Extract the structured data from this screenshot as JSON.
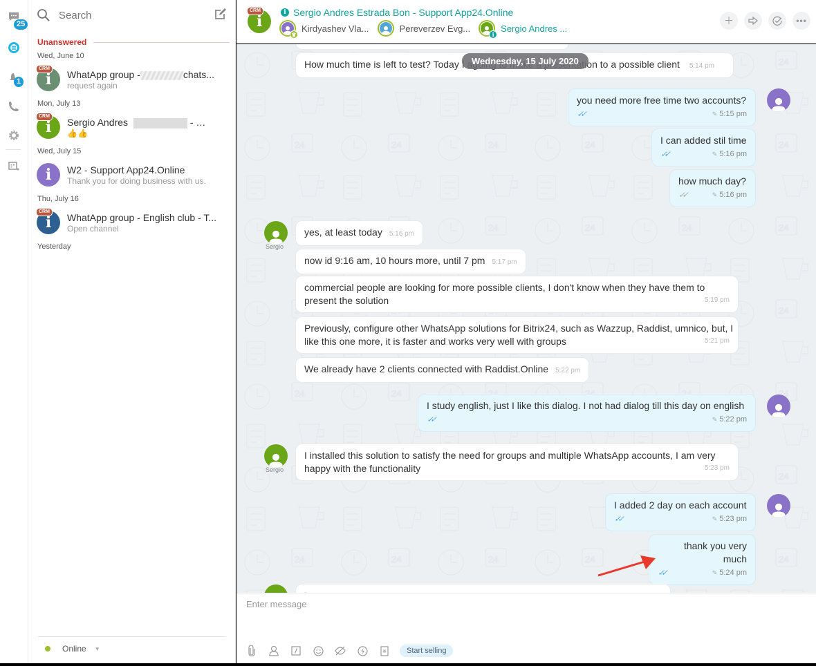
{
  "rail": {
    "chats_badge": "25",
    "notifications_badge": "1",
    "items": [
      {
        "name": "chats",
        "icon": "chat-bubble-icon"
      },
      {
        "name": "open-lines",
        "icon": "open-lines-icon"
      },
      {
        "name": "notifications",
        "icon": "bell-icon"
      },
      {
        "name": "calls",
        "icon": "phone-icon"
      },
      {
        "name": "settings",
        "icon": "gear-icon"
      },
      {
        "name": "dialog-list",
        "icon": "list-export-icon"
      }
    ]
  },
  "recent": {
    "search_placeholder": "Search",
    "unanswered_label": "Unanswered",
    "groups": [
      {
        "date": "Wed, June 10",
        "chat": {
          "title_prefix": "WhatApp group  -",
          "title_suffix": "chats...",
          "subtitle": "request again",
          "avatar_color": "#6b8f73",
          "crm": true
        }
      },
      {
        "date": "Mon, July 13",
        "chat": {
          "title_prefix": "Sergio Andres",
          "title_suffix": "-",
          "subtitle": "👍👍",
          "avatar_color": "#6aa618",
          "crm": true
        }
      },
      {
        "date": "Wed, July 15",
        "chat": {
          "title": "W2   - Support App24.Online",
          "subtitle": "Thank you for doing business with us.",
          "avatar_color": "#8a72c8",
          "crm": false
        }
      },
      {
        "date": "Thu, July 16",
        "chat": {
          "title": "WhatApp  group  - English club - T...",
          "subtitle": "Open channel",
          "avatar_color": "#2d6091",
          "crm": true
        }
      },
      {
        "date": "Yesterday"
      }
    ],
    "status": "Online"
  },
  "header": {
    "crm_tag": "CRM",
    "title": "Sergio Andres Estrada Bon - Support App24.Online",
    "participants": [
      {
        "name": "Kirdyashev Vla...",
        "color": "#8a72c8",
        "badge": "crown",
        "badge_color": "#9dc02e"
      },
      {
        "name": "Pereverzev Evg...",
        "color": "#55a5d6",
        "badge": null
      },
      {
        "name": "Sergio Andres ...",
        "color": "#6aa618",
        "badge": "info",
        "badge_color": "#12a39d",
        "highlight": true
      }
    ],
    "actions": [
      "add-user",
      "forward",
      "finish",
      "more"
    ]
  },
  "messages": {
    "date_pill": "Wednesday, 15 July 2020",
    "items": [
      {
        "own": false,
        "text": "How much time is left to test? Today I am going to make a presentation to a possible client",
        "time": "5:14 pm"
      },
      {
        "own": true,
        "text": "you need more free time two accounts?",
        "time": "5:15 pm",
        "read": true
      },
      {
        "own": true,
        "text": "I can added stil time",
        "time": "5:16 pm",
        "read": true
      },
      {
        "own": true,
        "text": "how much day?",
        "time": "5:16 pm",
        "read": false
      },
      {
        "own": false,
        "author": "Sergio",
        "text": "yes, at least today",
        "time": "5:16 pm"
      },
      {
        "own": false,
        "text": "now id 9:16 am, 10 hours more, until 7 pm",
        "time": "5:17 pm"
      },
      {
        "own": false,
        "text": "commercial people are looking for more possible clients, I don't know when they have them to present the solution",
        "time": "5:19 pm"
      },
      {
        "own": false,
        "text": "Previously, configure other WhatsApp solutions for Bitrix24, such as Wazzup, Raddist, umnico, but, I like this one more, it is faster and works very well with groups",
        "time": "5:21 pm"
      },
      {
        "own": false,
        "text": "We already have 2 clients connected with Raddist.Online",
        "time": "5:22 pm"
      },
      {
        "own": true,
        "text": "I study english,  just I like this dialog. I not had dialog till this day on english",
        "time": "5:22 pm",
        "read": true
      },
      {
        "own": false,
        "author": "Sergio",
        "text": "I installed this solution to satisfy the need for groups and multiple WhatsApp accounts, I am very happy with the functionality",
        "time": "5:23 pm"
      },
      {
        "own": true,
        "text": "I added 2 day on each account",
        "time": "5:23 pm",
        "read": true
      },
      {
        "own": true,
        "text": "thank you very much",
        "time": "5:24 pm",
        "read": true
      },
      {
        "own": false,
        "text": "I",
        "time": ""
      }
    ],
    "visible_fragments": {
      "first_left": "How much time is left to test? Today I a",
      "first_right": "tation to a possible client",
      "pill_overlap": "going to make a presen"
    }
  },
  "composer": {
    "placeholder": "Enter message",
    "start_selling": "Start selling",
    "tools": [
      "paperclip-icon",
      "contact-icon",
      "command-icon",
      "smile-icon",
      "hide-icon",
      "lightning-icon",
      "document-icon"
    ]
  },
  "colors": {
    "accent": "#12a39d",
    "own_bubble": "#e5f6fd",
    "unanswered": "#d0312d",
    "online": "#9dc02e",
    "badge": "#1a9dd9"
  }
}
